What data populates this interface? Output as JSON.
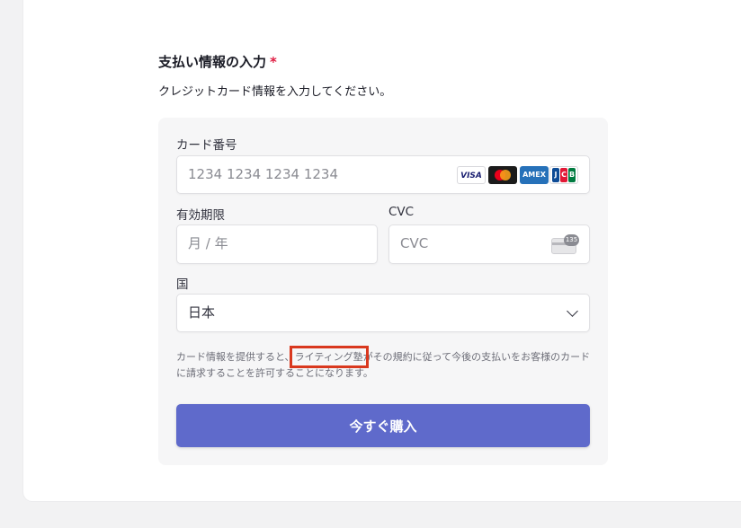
{
  "section": {
    "title": "支払い情報の入力",
    "required_mark": "*",
    "description": "クレジットカード情報を入力してください。"
  },
  "card_number": {
    "label": "カード番号",
    "placeholder": "1234 1234 1234 1234",
    "brands": [
      "VISA",
      "Mastercard",
      "AMEX",
      "JCB"
    ]
  },
  "expiry": {
    "label": "有効期限",
    "placeholder": "月 / 年"
  },
  "cvc": {
    "label": "CVC",
    "placeholder": "CVC",
    "icon_text": "135"
  },
  "country": {
    "label": "国",
    "selected": "日本"
  },
  "terms": {
    "prefix": "カード情報を提供すると、",
    "merchant": "ライティング塾",
    "suffix": "がその規約に従って今後の支払いをお客様のカードに請求することを許可することになります。"
  },
  "buy_button": {
    "label": "今すぐ購入"
  },
  "colors": {
    "button": "#5f6acb",
    "required": "#df1b41",
    "highlight": "#d9381e"
  }
}
